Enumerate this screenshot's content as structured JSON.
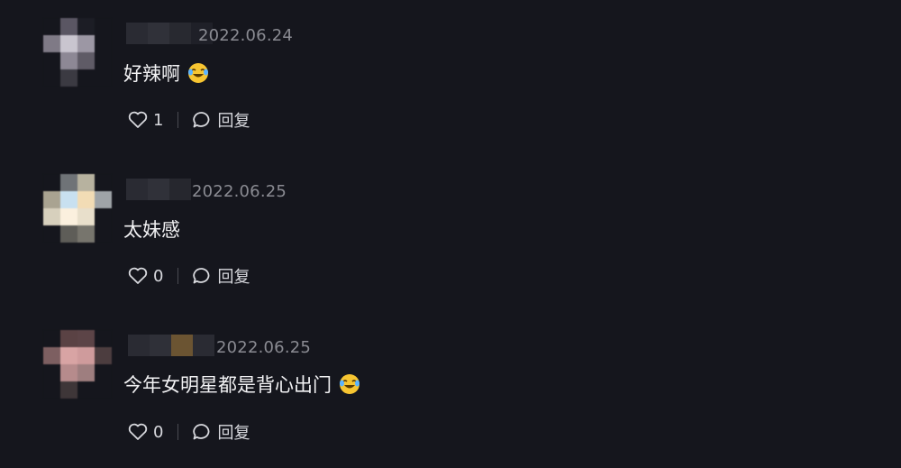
{
  "comments": [
    {
      "date": "2022.06.24",
      "text": "好辣啊",
      "emoji": "laughing-crying-emoji",
      "likes": "1",
      "reply_label": "回复"
    },
    {
      "date": "2022.06.25",
      "text": "太妹感",
      "likes": "0",
      "reply_label": "回复"
    },
    {
      "date": "2022.06.25",
      "text": "今年女明星都是背心出门",
      "emoji": "laughing-crying-emoji",
      "likes": "0",
      "reply_label": "回复"
    }
  ],
  "colors": {
    "background": "#15161d",
    "date": "#8a8b92",
    "text": "#f2f2f4"
  },
  "icons": {
    "like": "heart-outline-icon",
    "reply": "speech-bubble-icon"
  }
}
